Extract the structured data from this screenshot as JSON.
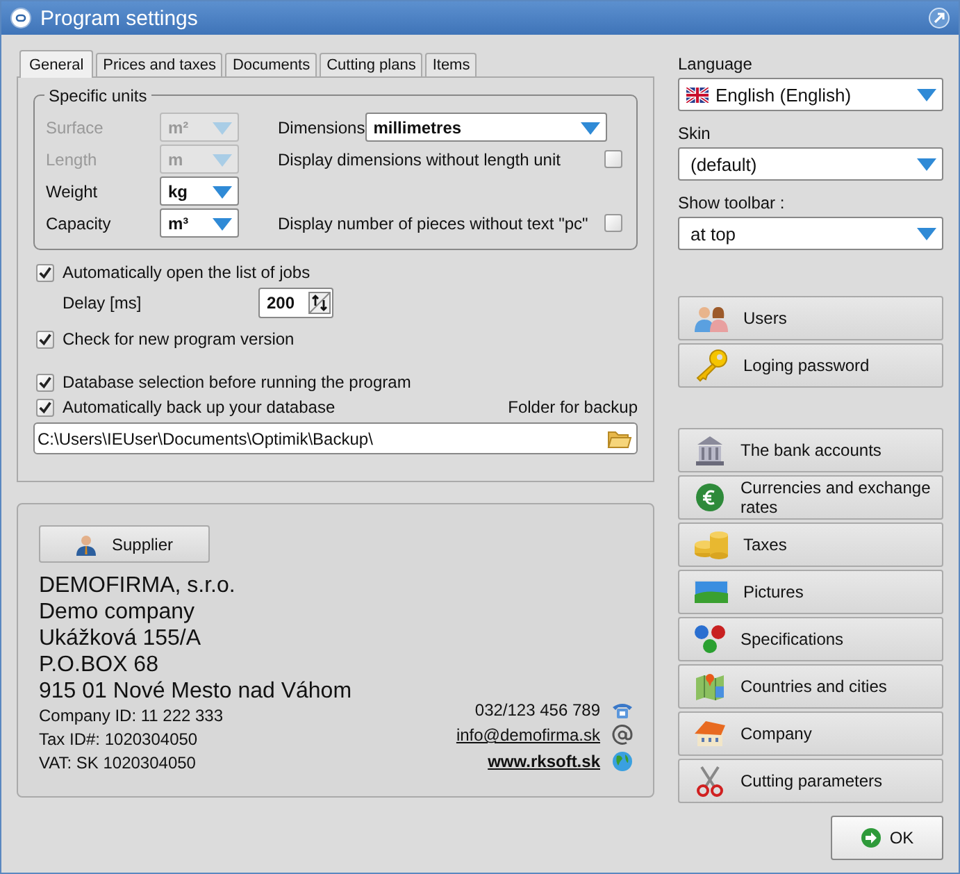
{
  "window": {
    "title": "Program settings"
  },
  "tabs": [
    {
      "label": "General",
      "selected": true
    },
    {
      "label": "Prices and taxes",
      "selected": false
    },
    {
      "label": "Documents",
      "selected": false
    },
    {
      "label": "Cutting plans",
      "selected": false
    },
    {
      "label": "Items",
      "selected": false
    }
  ],
  "specific_units": {
    "title": "Specific units",
    "units": [
      {
        "label": "Surface",
        "value": "m²",
        "disabled": true
      },
      {
        "label": "Length",
        "value": "m",
        "disabled": true
      },
      {
        "label": "Weight",
        "value": "kg",
        "disabled": false
      },
      {
        "label": "Capacity",
        "value": "m³",
        "disabled": false
      }
    ],
    "dimensions": {
      "label": "Dimensions",
      "value": "millimetres"
    },
    "options": [
      {
        "label": "Display dimensions without length unit",
        "checked": false
      },
      {
        "label": "Display number of pieces without text \"pc\"",
        "checked": false
      }
    ]
  },
  "auto_open_jobs": {
    "label": "Automatically open the list of jobs",
    "checked": true
  },
  "delay": {
    "label": "Delay [ms]",
    "value": "200"
  },
  "check_version": {
    "label": "Check for new program version",
    "checked": true
  },
  "database_selection": {
    "label": "Database selection before running the program",
    "checked": true
  },
  "auto_backup": {
    "label": "Automatically back up your database",
    "checked": true
  },
  "backup_folder": {
    "label": "Folder for backup",
    "value": "C:\\Users\\IEUser\\Documents\\Optimik\\Backup\\"
  },
  "supplier": {
    "button": "Supplier",
    "lines": [
      "DEMOFIRMA, s.r.o.",
      "Demo company",
      "Ukážková 155/A",
      "P.O.BOX 68",
      "915 01  Nové Mesto nad Váhom"
    ],
    "ids": [
      "Company ID: 11 222 333",
      "Tax ID#: 1020304050",
      "VAT: SK 1020304050"
    ],
    "contacts": [
      {
        "kind": "phone",
        "text": "032/123 456 789"
      },
      {
        "kind": "email",
        "text": "info@demofirma.sk"
      },
      {
        "kind": "web",
        "text": "www.rksoft.sk"
      }
    ]
  },
  "language": {
    "label": "Language",
    "value": "English (English)"
  },
  "skin": {
    "label": "Skin",
    "value": "(default)"
  },
  "toolbar": {
    "label": "Show toolbar :",
    "value": "at top"
  },
  "user_buttons": [
    "Users",
    "Loging password"
  ],
  "data_buttons": [
    "The bank accounts",
    "Currencies and exchange rates",
    "Taxes",
    "Pictures",
    "Specifications",
    "Countries and cities",
    "Company",
    "Cutting parameters"
  ],
  "ok_button": "OK"
}
